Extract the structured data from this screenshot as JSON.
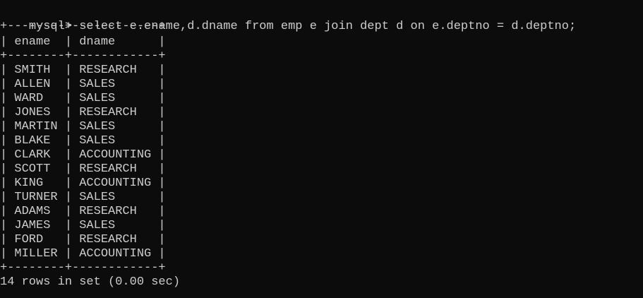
{
  "terminal": {
    "background": "#0c0c0c",
    "foreground": "#cccccc",
    "prompt": "mysql> ",
    "command": "select e.ename,d.dname from emp e join dept d on e.deptno = d.deptno;",
    "border_line": "+--------+------------+",
    "header_row": "| ename  | dname      |",
    "rows": [
      "| SMITH  | RESEARCH   |",
      "| ALLEN  | SALES      |",
      "| WARD   | SALES      |",
      "| JONES  | RESEARCH   |",
      "| MARTIN | SALES      |",
      "| BLAKE  | SALES      |",
      "| CLARK  | ACCOUNTING |",
      "| SCOTT  | RESEARCH   |",
      "| KING   | ACCOUNTING |",
      "| TURNER | SALES      |",
      "| ADAMS  | RESEARCH   |",
      "| JAMES  | SALES      |",
      "| FORD   | RESEARCH   |",
      "| MILLER | ACCOUNTING |"
    ],
    "summary": "14 rows in set (0.00 sec)"
  }
}
